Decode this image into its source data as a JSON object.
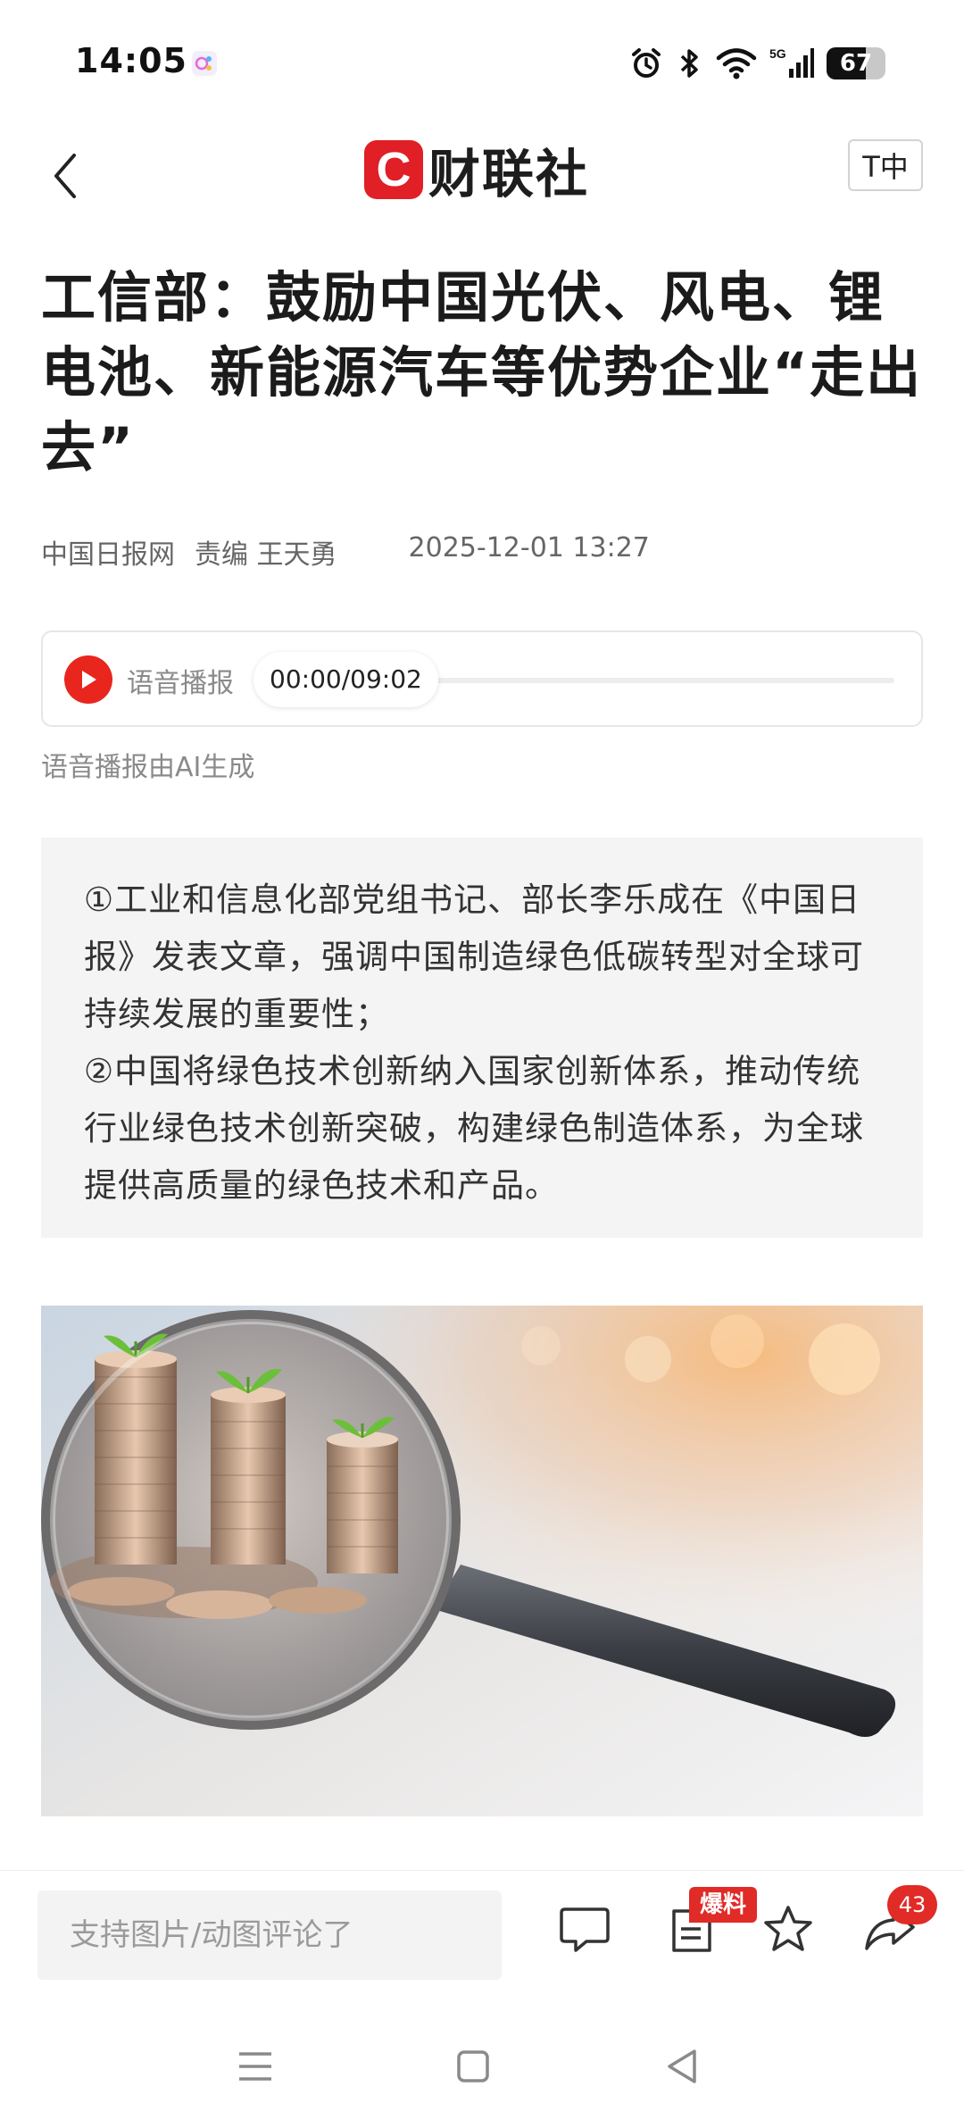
{
  "status_bar": {
    "time": "14:05",
    "battery": "67",
    "battery_level": 0.67,
    "icons": [
      "app-notification-icon",
      "alarm-icon",
      "bluetooth-icon",
      "wifi-icon",
      "5g-signal-icon",
      "battery-icon"
    ]
  },
  "nav": {
    "logo_mark": "C",
    "logo_text": "财联社",
    "font_size_label": "T中"
  },
  "article": {
    "title": "工信部：鼓励中国光伏、风电、锂电池、新能源汽车等优势企业“走出去”",
    "source": "中国日报网",
    "editor": "责编 王天勇",
    "datetime": "2025-12-01 13:27"
  },
  "audio": {
    "label": "语音播报",
    "time": "00:00/09:02",
    "progress": 0,
    "ai_note": "语音播报由AI生成"
  },
  "summary": {
    "point_1": "①工业和信息化部党组书记、部长李乐成在《中国日报》发表文章，强调中国制造绿色低碳转型对全球可持续发展的重要性；",
    "point_2": "②中国将绿色技术创新纳入国家创新体系，推动传统行业绿色技术创新突破，构建绿色制造体系，为全球提供高质量的绿色技术和产品。"
  },
  "toolbar": {
    "comment_placeholder": "支持图片/动图评论了",
    "tip_badge": "爆料",
    "share_count": "43"
  },
  "colors": {
    "brand_red": "#e01f26",
    "badge_red": "#e02b27",
    "summary_bg": "#f4f4f4"
  }
}
